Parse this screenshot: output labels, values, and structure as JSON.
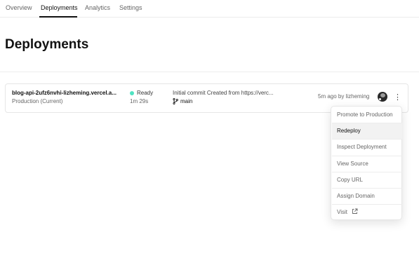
{
  "tabs": [
    {
      "label": "Overview"
    },
    {
      "label": "Deployments"
    },
    {
      "label": "Analytics"
    },
    {
      "label": "Settings"
    }
  ],
  "page_title": "Deployments",
  "deployment": {
    "url": "blog-api-2ufz6nvhi-lizheming.vercel.a...",
    "environment": "Production (Current)",
    "status": "Ready",
    "status_color": "#50e3c2",
    "duration": "1m 29s",
    "commit_message": "Initial commit Created from https://verc...",
    "branch": "main",
    "meta": "5m ago by lizheming"
  },
  "menu": {
    "items": [
      {
        "label": "Promote to Production"
      },
      {
        "label": "Redeploy"
      },
      {
        "label": "Inspect Deployment"
      },
      {
        "label": "View Source"
      },
      {
        "label": "Copy URL"
      },
      {
        "label": "Assign Domain"
      },
      {
        "label": "Visit"
      }
    ]
  },
  "icons": {
    "more": "more-vertical-icon",
    "branch": "git-branch-icon",
    "external": "external-link-icon"
  }
}
